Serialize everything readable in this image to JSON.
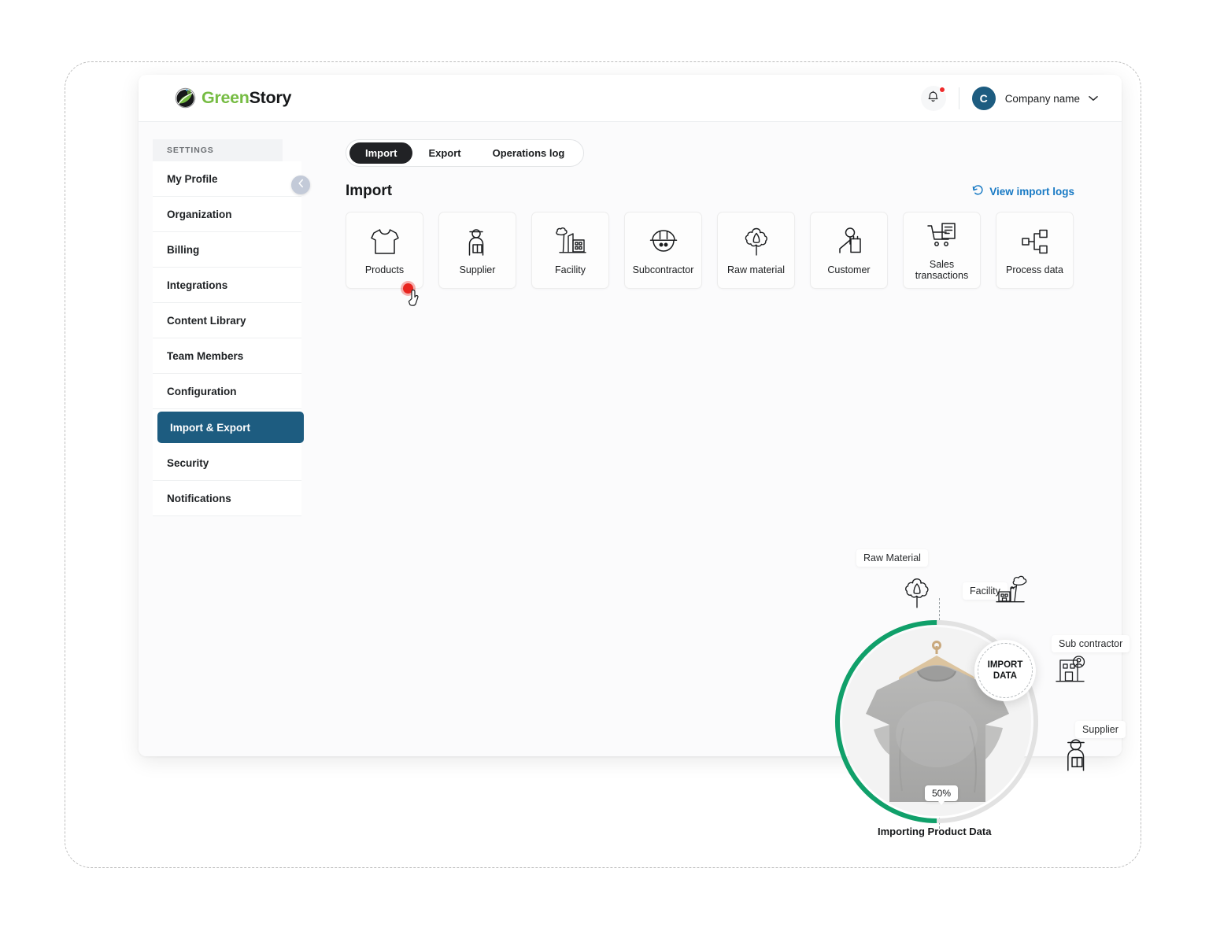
{
  "brand": {
    "name_part_green": "Green",
    "name_part_dark": "Story"
  },
  "topbar": {
    "bell_icon": "bell-icon",
    "notification_badge": "",
    "avatar_initial": "C",
    "company_name": "Company name",
    "caret_icon": "chevron-down-icon"
  },
  "sidebar": {
    "section_label": "SETTINGS",
    "collapse_icon": "chevron-left-icon",
    "items": [
      {
        "label": "My Profile",
        "active": false
      },
      {
        "label": "Organization",
        "active": false
      },
      {
        "label": "Billing",
        "active": false
      },
      {
        "label": "Integrations",
        "active": false
      },
      {
        "label": "Content Library",
        "active": false
      },
      {
        "label": "Team Members",
        "active": false
      },
      {
        "label": "Configuration",
        "active": false
      },
      {
        "label": "Import & Export",
        "active": true
      },
      {
        "label": "Security",
        "active": false
      },
      {
        "label": "Notifications",
        "active": false
      }
    ]
  },
  "main": {
    "tabs": [
      {
        "label": "Import",
        "active": true
      },
      {
        "label": "Export",
        "active": false
      },
      {
        "label": "Operations log",
        "active": false
      }
    ],
    "section_title": "Import",
    "logs_link": {
      "label": "View import logs",
      "icon": "history-revert-icon"
    },
    "cards": [
      {
        "label": "Products",
        "icon": "tshirt-icon"
      },
      {
        "label": "Supplier",
        "icon": "supplier-person-box-icon"
      },
      {
        "label": "Facility",
        "icon": "factory-icon"
      },
      {
        "label": "Subcontractor",
        "icon": "hardhat-icon"
      },
      {
        "label": "Raw material",
        "icon": "cotton-boll-icon"
      },
      {
        "label": "Customer",
        "icon": "customer-shopping-bag-icon"
      },
      {
        "label": "Sales transactions",
        "icon": "shopping-cart-receipt-icon"
      },
      {
        "label": "Process data",
        "icon": "process-nodes-icon"
      }
    ]
  },
  "illustration": {
    "badge_line1": "IMPORT",
    "badge_line2": "DATA",
    "progress_label": "50%",
    "progress_value": 50,
    "caption": "Importing Product Data",
    "chips": [
      {
        "label": "Raw Material",
        "icon": "cotton-boll-icon"
      },
      {
        "label": "Facility",
        "icon": "factory-smoke-icon"
      },
      {
        "label": "Sub contractor",
        "icon": "building-person-icon"
      },
      {
        "label": "Supplier",
        "icon": "supplier-person-box-icon"
      }
    ],
    "product_image": "grey-tshirt-on-hanger"
  },
  "cursor": {
    "icon": "hand-pointer-cursor",
    "click_indicator": "red-click-dot"
  },
  "colors": {
    "brand_green": "#76bc43",
    "accent_blue": "#1779c4",
    "sidebar_active": "#1d5c80",
    "tab_active": "#212225",
    "progress_green": "#10a06a",
    "click_red": "#e8251f"
  }
}
